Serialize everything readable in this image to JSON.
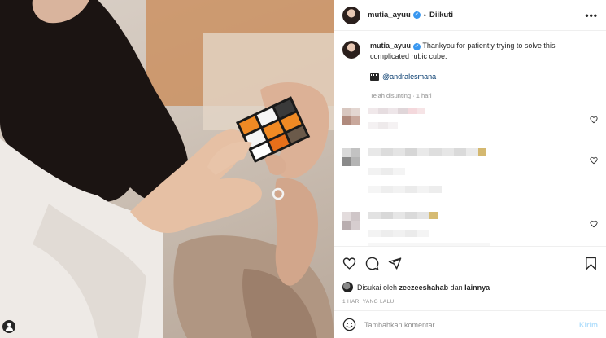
{
  "post": {
    "author": "mutia_ayuu",
    "follow_state": "Diikuti",
    "separator": "•"
  },
  "caption": {
    "username": "mutia_ayuu",
    "text": "Thankyou for patiently trying to solve this complicated rubic cube.",
    "mention": "@andralesmana",
    "edited_label": "Telah disunting",
    "edited_time": "1 hari"
  },
  "likes": {
    "prefix": "Disukai oleh",
    "first_liker": "zeezeeshahab",
    "joiner": "dan",
    "others": "lainnya"
  },
  "timestamp": "1 HARI YANG LALU",
  "comment_box": {
    "placeholder": "Tambahkan komentar...",
    "post_label": "Kirim"
  },
  "icons": {
    "verified": "verified-badge-icon",
    "more": "more-options-icon",
    "like": "heart-icon",
    "comment": "comment-icon",
    "share": "share-icon",
    "save": "bookmark-icon",
    "emoji": "emoji-icon",
    "tag": "user-tag-icon",
    "clapper": "clapperboard-icon"
  },
  "colors": {
    "verified": "#3897f0",
    "link": "#00376b",
    "post_button": "#b2dffc",
    "secondary_text": "#8e8e8e"
  }
}
